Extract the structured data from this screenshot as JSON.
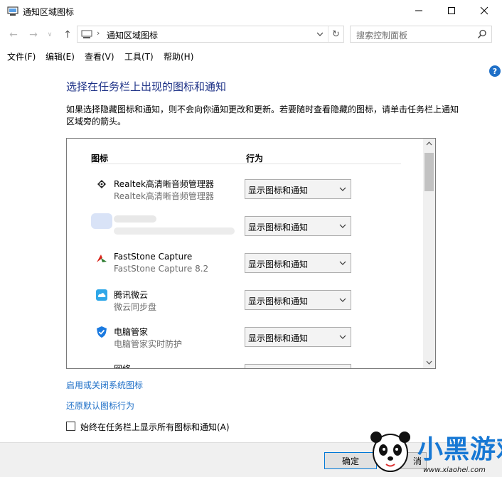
{
  "window": {
    "title": "通知区域图标"
  },
  "nav": {
    "back_glyph": "←",
    "forward_glyph": "→",
    "dropdown_glyph": "∨",
    "up_glyph": "↑",
    "breadcrumb_sep": "›",
    "address": "通知区域图标",
    "refresh_glyph": "↻",
    "search_placeholder": "搜索控制面板"
  },
  "menu": [
    "文件(F)",
    "编辑(E)",
    "查看(V)",
    "工具(T)",
    "帮助(H)"
  ],
  "help_glyph": "?",
  "heading": "选择在任务栏上出现的图标和通知",
  "description": "如果选择隐藏图标和通知，则不会向你通知更改和更新。若要随时查看隐藏的图标，请单击任务栏上通知区域旁的箭头。",
  "table": {
    "col_icon": "图标",
    "col_behavior": "行为",
    "rows": [
      {
        "icon": "speaker-icon",
        "name": "Realtek高清晰音频管理器",
        "sub": "Realtek高清晰音频管理器",
        "behavior": "显示图标和通知"
      },
      {
        "icon": "blurred-app-icon",
        "name": "",
        "sub": "",
        "behavior": "显示图标和通知"
      },
      {
        "icon": "faststone-capture-icon",
        "name": "FastStone Capture",
        "sub": "FastStone Capture 8.2",
        "behavior": "显示图标和通知"
      },
      {
        "icon": "weiyun-cloud-icon",
        "name": "腾讯微云",
        "sub": "微云同步盘",
        "behavior": "显示图标和通知"
      },
      {
        "icon": "pc-manager-shield-icon",
        "name": "电脑管家",
        "sub": "电脑管家实时防护",
        "behavior": "显示图标和通知"
      },
      {
        "icon": "network-icon",
        "name": "网络",
        "sub": "",
        "behavior": ""
      }
    ]
  },
  "links": {
    "system_icons": "启用或关闭系统图标",
    "restore_default": "还原默认图标行为"
  },
  "checkbox": {
    "label": "始终在任务栏上显示所有图标和通知(A)",
    "checked": false
  },
  "buttons": {
    "ok": "确定",
    "cancel_fragment": "消"
  },
  "watermark": {
    "text": "小黑游戏",
    "url": "www.xiaohei.com"
  },
  "colors": {
    "heading": "#1e3287",
    "link": "#1e6fc7",
    "watermark": "#1778d4"
  }
}
